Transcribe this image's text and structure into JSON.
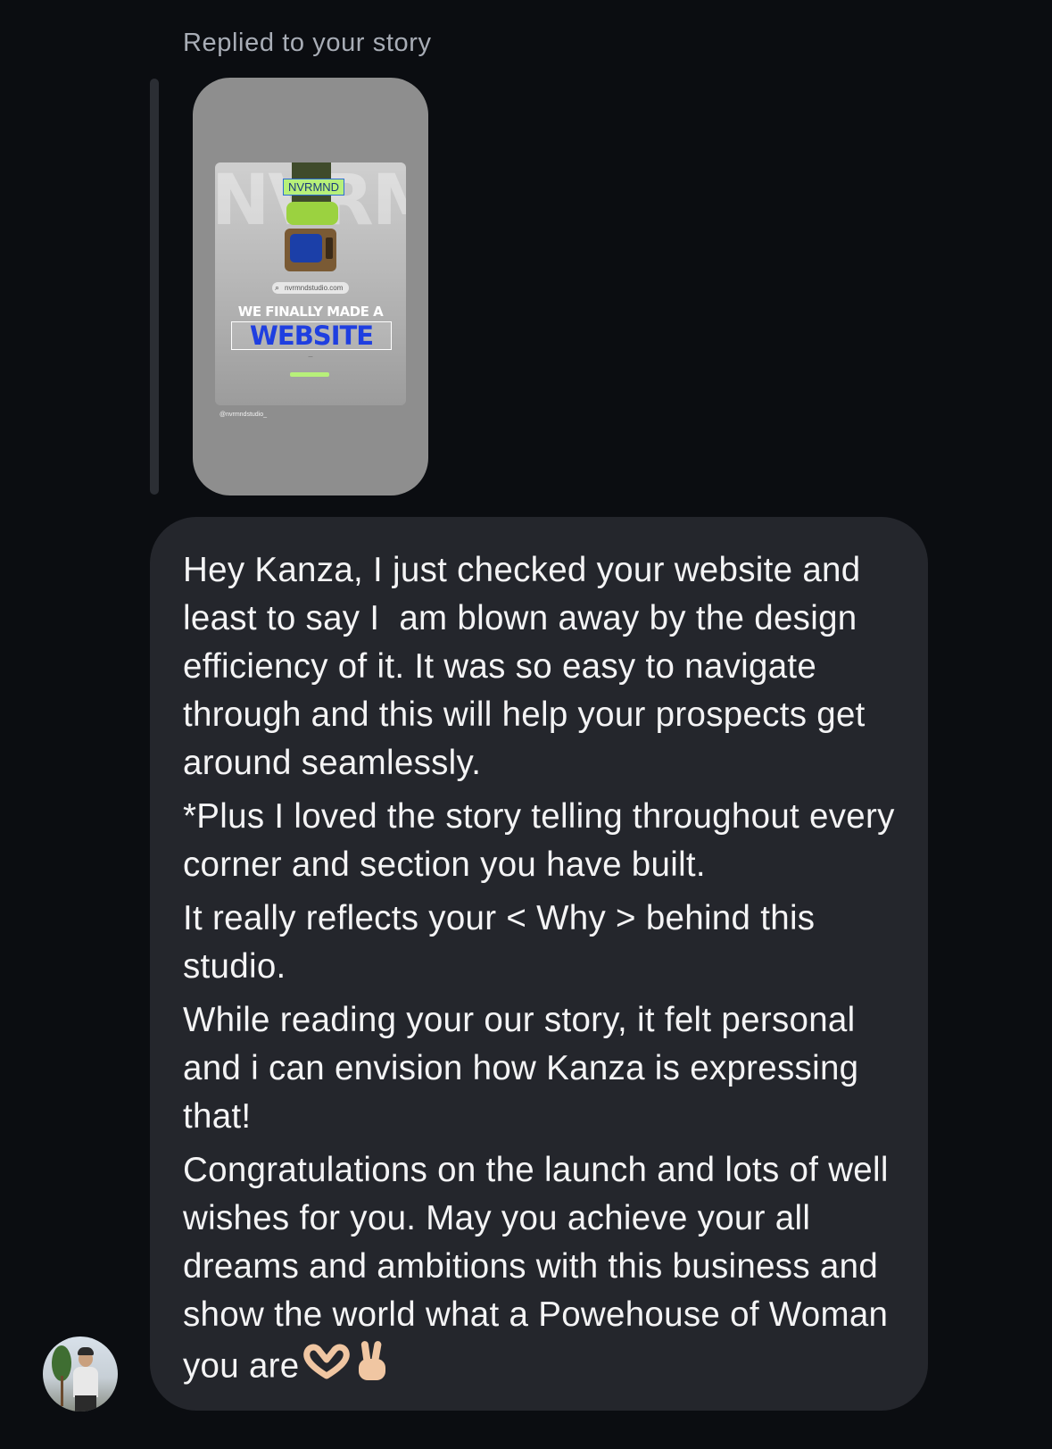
{
  "reply": {
    "label": "Replied to your story"
  },
  "story": {
    "brand": "NVRMND",
    "bg_letters": "NVRMN",
    "search_url": "nvrmndstudio.com",
    "headline": "WE FINALLY MADE A",
    "headline_big": "WEBSITE",
    "handle": "@nvrmndstudio_"
  },
  "message": {
    "paragraphs": [
      "Hey Kanza, I just checked your website and least to say I  am blown away by the design efficiency of it. It was so easy to navigate through and this will help your prospects get around seamlessly.",
      "*Plus I loved the story telling throughout every corner and section you have built.",
      "It really reflects your < Why > behind this studio.",
      "While reading your our story, it felt personal and i can envision how Kanza is expressing that!",
      "Congratulations on the launch and lots of well wishes for you. May you achieve your all dreams and ambitions with this business and show the world what a Powehouse of Woman you are"
    ],
    "emojis": [
      "heart-hands",
      "victory-hand"
    ]
  },
  "colors": {
    "background": "#0b0d11",
    "bubble": "#24262c",
    "story_bg": "#8e8e8e",
    "accent_green": "#b7f07a",
    "accent_blue": "#1f3fe0"
  }
}
